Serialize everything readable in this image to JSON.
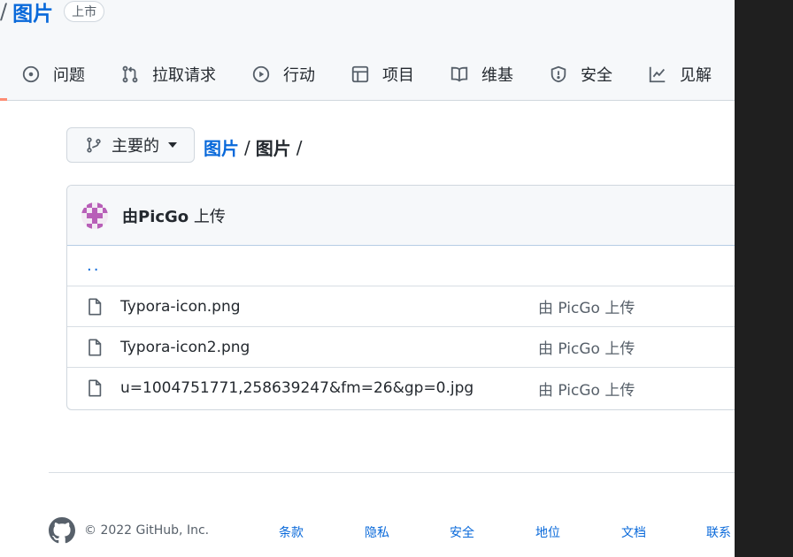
{
  "repo": {
    "separator": "/",
    "name": "图片",
    "visibility": "上市"
  },
  "tabs": [
    {
      "label": "问题",
      "icon": "issue-icon"
    },
    {
      "label": "拉取请求",
      "icon": "pull-request-icon"
    },
    {
      "label": "行动",
      "icon": "play-icon"
    },
    {
      "label": "项目",
      "icon": "table-icon"
    },
    {
      "label": "维基",
      "icon": "book-icon"
    },
    {
      "label": "安全",
      "icon": "shield-icon"
    },
    {
      "label": "见解",
      "icon": "graph-icon"
    }
  ],
  "branch": {
    "label": "主要的"
  },
  "path": {
    "root": "图片",
    "sep1": "/",
    "current": "图片",
    "sep2": "/"
  },
  "commit": {
    "by": "由",
    "author": "PicGo",
    "action": "上传"
  },
  "parent_dir": "..",
  "files": [
    {
      "name": "Typora-icon.png",
      "commit": "由 PicGo 上传"
    },
    {
      "name": "Typora-icon2.png",
      "commit": "由 PicGo 上传"
    },
    {
      "name": "u=1004751771,258639247&fm=26&gp=0.jpg",
      "commit": "由 PicGo 上传"
    }
  ],
  "footer": {
    "copyright": "© 2022 GitHub, Inc.",
    "links": [
      "条款",
      "隐私",
      "安全",
      "地位",
      "文档",
      "联系"
    ]
  },
  "colors": {
    "accent": "#0969da",
    "header_bg": "#f6f8fa",
    "border": "#d0d7de",
    "tab_underline": "#fd8c73",
    "avatar": "#b85fb8"
  }
}
